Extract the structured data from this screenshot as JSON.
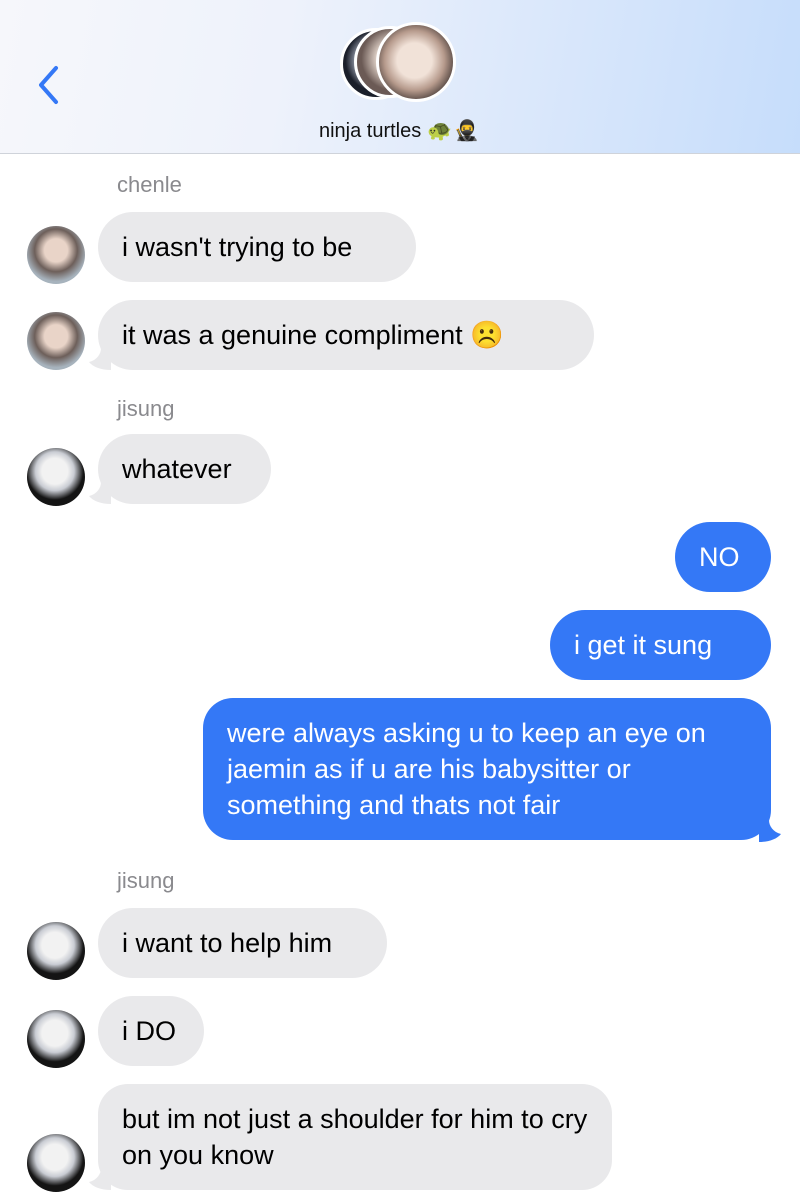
{
  "header": {
    "group_name": "ninja turtles",
    "group_emoji": "🐢🥷",
    "back_icon": "chevron-left-icon",
    "accent": "#3478f6"
  },
  "colors": {
    "incoming_bubble": "#e9e9eb",
    "outgoing_bubble": "#3478f6",
    "sender_label": "#8a8a8e"
  },
  "messages": [
    {
      "sender": "chenle",
      "text": "i wasn't trying to be"
    },
    {
      "sender": "chenle",
      "text": "it was a genuine compliment ☹️"
    },
    {
      "sender": "jisung",
      "text": "whatever"
    },
    {
      "sender": "me",
      "text": "NO"
    },
    {
      "sender": "me",
      "text": "i get it sung"
    },
    {
      "sender": "me",
      "text": "were always asking u to keep an eye on jaemin as if u are his babysitter or something and thats not fair"
    },
    {
      "sender": "jisung",
      "text": "i want to help him"
    },
    {
      "sender": "jisung",
      "text": "i DO"
    },
    {
      "sender": "jisung",
      "text": "but im not just a shoulder for him to cry on you know"
    }
  ]
}
